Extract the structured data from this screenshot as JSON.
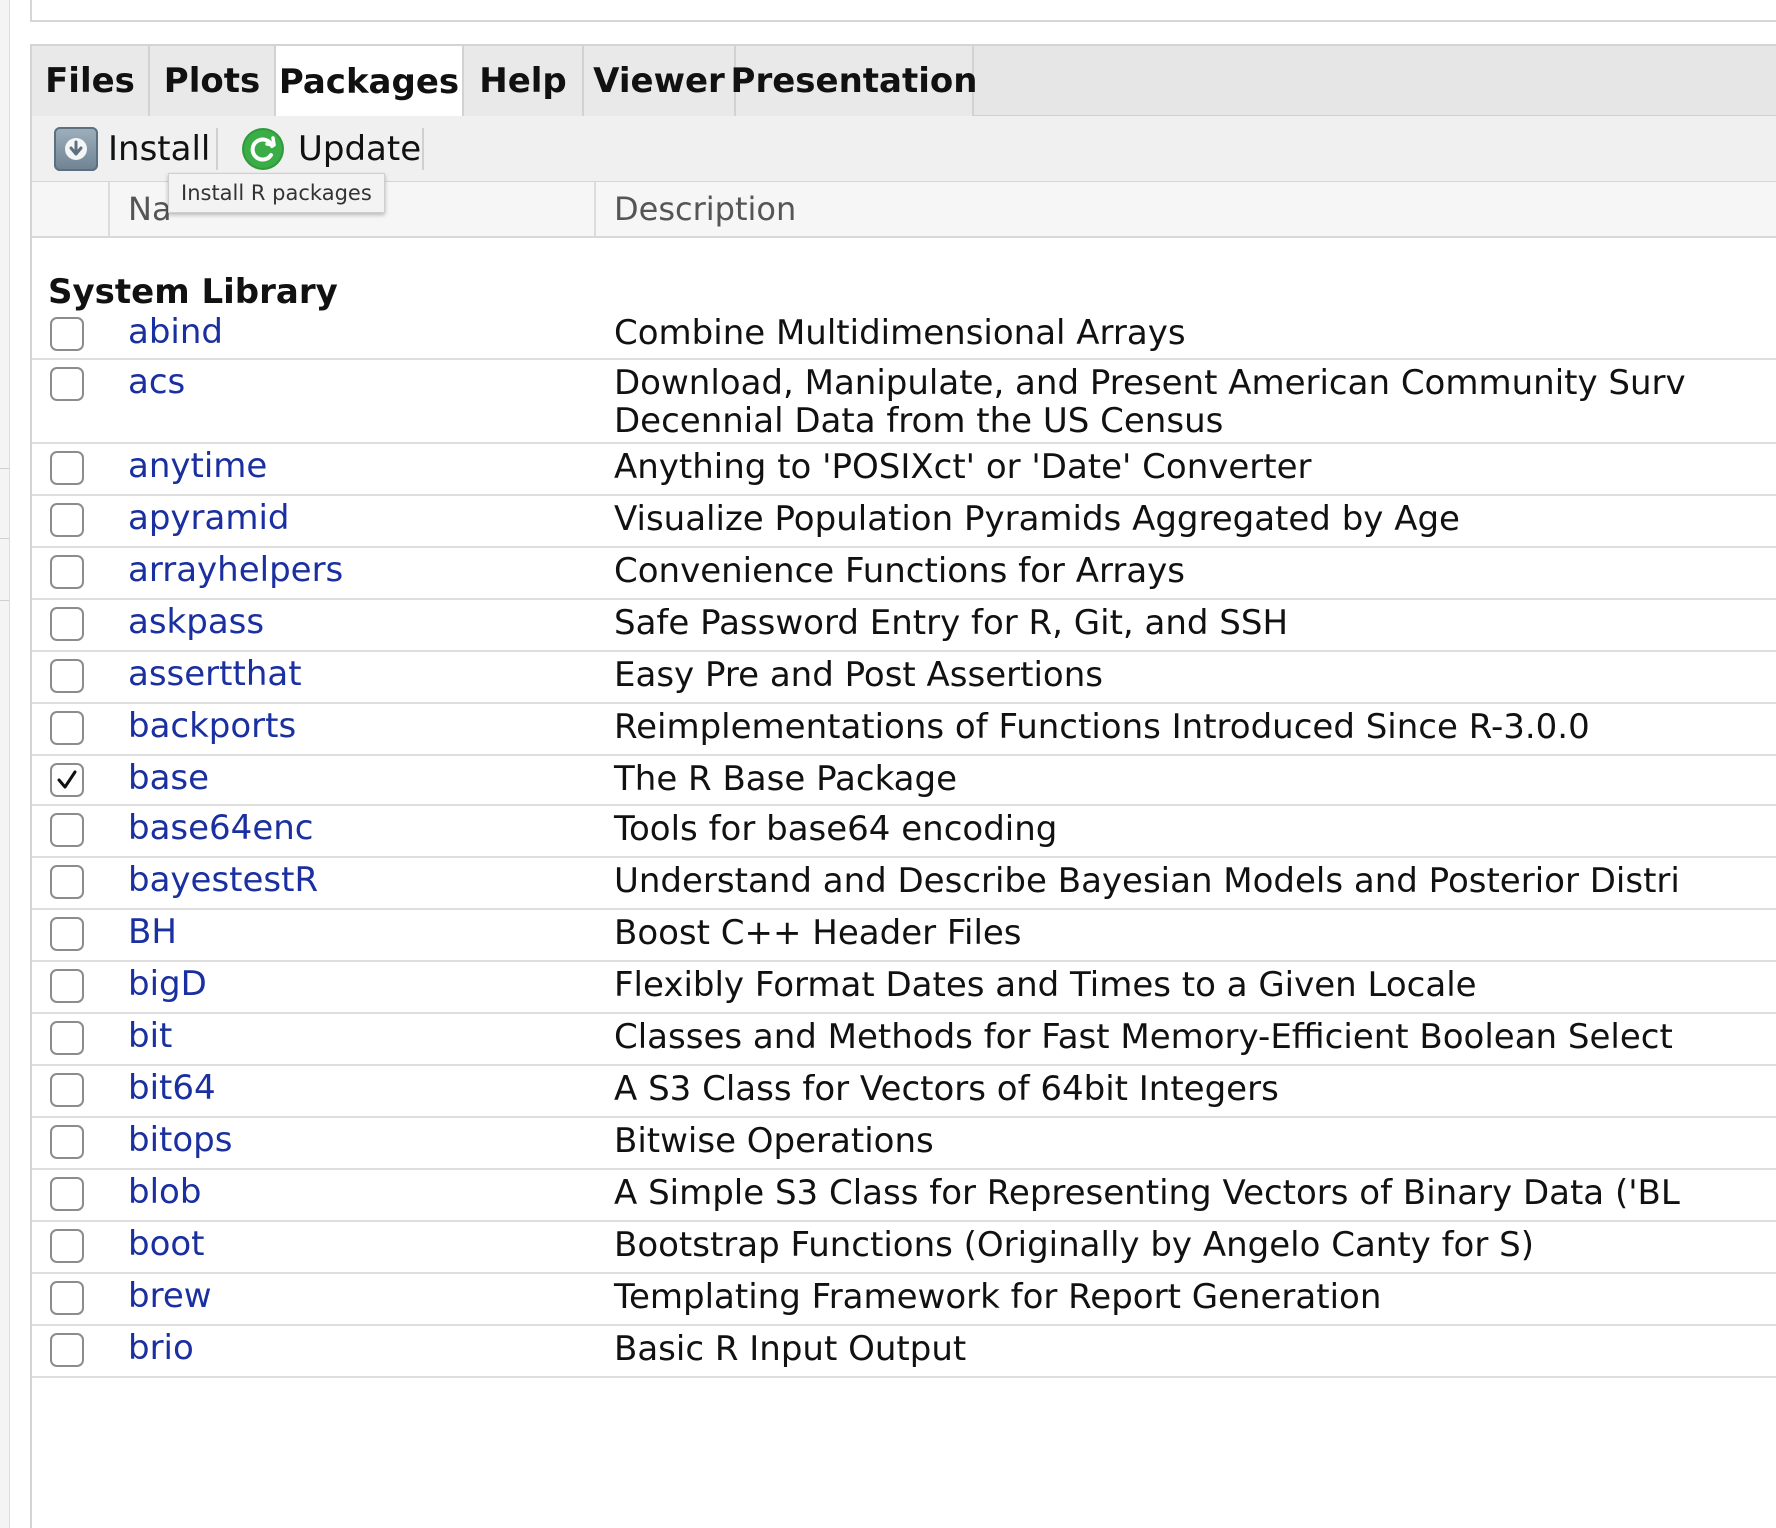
{
  "tabs": [
    {
      "label": "Files",
      "active": false
    },
    {
      "label": "Plots",
      "active": false
    },
    {
      "label": "Packages",
      "active": true
    },
    {
      "label": "Help",
      "active": false
    },
    {
      "label": "Viewer",
      "active": false
    },
    {
      "label": "Presentation",
      "active": false
    }
  ],
  "toolbar": {
    "install_label": "Install",
    "install_icon": "install-icon",
    "update_label": "Update",
    "update_icon": "refresh-icon",
    "update_color": "#2e9a3a"
  },
  "tooltip": {
    "text": "Install R packages"
  },
  "table": {
    "columns": {
      "name": "Na",
      "description": "Description"
    },
    "group": "System Library",
    "name_color": "#1a2fa0",
    "packages": [
      {
        "name": "abind",
        "description": [
          "Combine Multidimensional Arrays"
        ],
        "checked": false
      },
      {
        "name": "acs",
        "description": [
          "Download, Manipulate, and Present American Community Surv",
          "Decennial Data from the US Census"
        ],
        "checked": false
      },
      {
        "name": "anytime",
        "description": [
          "Anything to 'POSIXct' or 'Date' Converter"
        ],
        "checked": false
      },
      {
        "name": "apyramid",
        "description": [
          "Visualize Population Pyramids Aggregated by Age"
        ],
        "checked": false
      },
      {
        "name": "arrayhelpers",
        "description": [
          "Convenience Functions for Arrays"
        ],
        "checked": false
      },
      {
        "name": "askpass",
        "description": [
          "Safe Password Entry for R, Git, and SSH"
        ],
        "checked": false
      },
      {
        "name": "assertthat",
        "description": [
          "Easy Pre and Post Assertions"
        ],
        "checked": false
      },
      {
        "name": "backports",
        "description": [
          "Reimplementations of Functions Introduced Since R-3.0.0"
        ],
        "checked": false
      },
      {
        "name": "base",
        "description": [
          "The R Base Package"
        ],
        "checked": true
      },
      {
        "name": "base64enc",
        "description": [
          "Tools for base64 encoding"
        ],
        "checked": false
      },
      {
        "name": "bayestestR",
        "description": [
          "Understand and Describe Bayesian Models and Posterior Distri"
        ],
        "checked": false
      },
      {
        "name": "BH",
        "description": [
          "Boost C++ Header Files"
        ],
        "checked": false
      },
      {
        "name": "bigD",
        "description": [
          "Flexibly Format Dates and Times to a Given Locale"
        ],
        "checked": false
      },
      {
        "name": "bit",
        "description": [
          "Classes and Methods for Fast Memory-Efficient Boolean Select"
        ],
        "checked": false
      },
      {
        "name": "bit64",
        "description": [
          "A S3 Class for Vectors of 64bit Integers"
        ],
        "checked": false
      },
      {
        "name": "bitops",
        "description": [
          "Bitwise Operations"
        ],
        "checked": false
      },
      {
        "name": "blob",
        "description": [
          "A Simple S3 Class for Representing Vectors of Binary Data ('BL"
        ],
        "checked": false
      },
      {
        "name": "boot",
        "description": [
          "Bootstrap Functions (Originally by Angelo Canty for S)"
        ],
        "checked": false
      },
      {
        "name": "brew",
        "description": [
          "Templating Framework for Report Generation"
        ],
        "checked": false
      },
      {
        "name": "brio",
        "description": [
          "Basic R Input Output"
        ],
        "checked": false
      }
    ]
  }
}
